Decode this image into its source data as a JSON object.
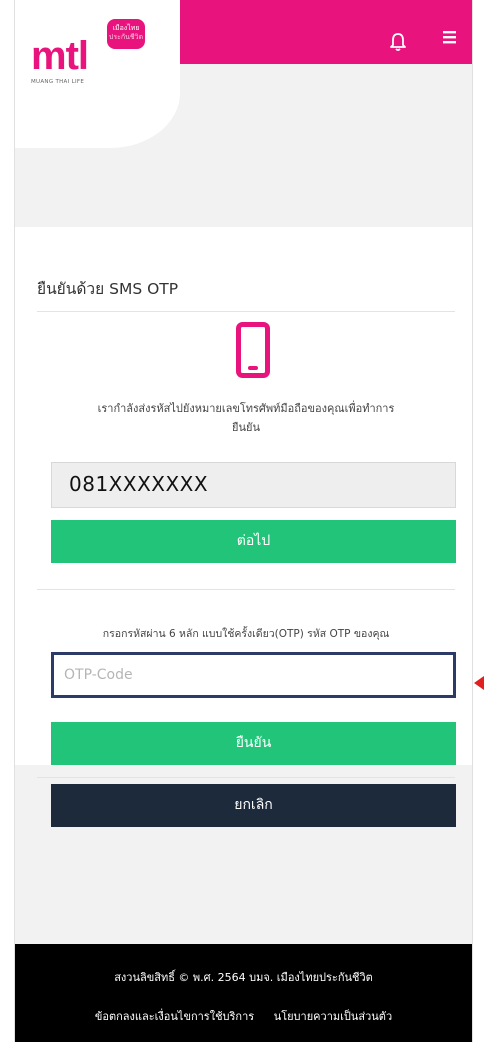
{
  "brand": {
    "logo_text": "mtl",
    "badge_line1": "เมืองไทย",
    "badge_line2": "ประกันชีวิต",
    "tagline": "MUANG THAI LIFE",
    "color": "#e8137c"
  },
  "header": {
    "icons": [
      "bell-icon",
      "menu-icon"
    ]
  },
  "verify": {
    "title": "ยืนยันด้วย SMS OTP",
    "icon": "mobile-phone-icon",
    "send_message_line1": "เรากำลังส่งรหัสไปยังหมายเลขโทรศัพท์มือถือของคุณเพื่อทำการ",
    "send_message_line2": "ยืนยัน",
    "phone_value": "081XXXXXXX",
    "next_label": "ต่อไป",
    "otp_instruction": "กรอกรหัสผ่าน 6 หลัก แบบใช้ครั้งเดียว(OTP) รหัส OTP ของคุณ",
    "otp_placeholder": "OTP-Code",
    "confirm_label": "ยืนยัน",
    "cancel_label": "ยกเลิก"
  },
  "footer": {
    "copyright": "สงวนลิขสิทธิ์ © พ.ศ. 2564 บมจ. เมืองไทยประกันชีวิต",
    "terms_link": "ข้อตกลงและเงื่อนไขการใช้บริการ",
    "privacy_link": "นโยบายความเป็นส่วนตัว"
  },
  "colors": {
    "accent_pink": "#e8137c",
    "button_green": "#22c47a",
    "button_dark": "#1d2a3c",
    "focus_border": "#2b3a67",
    "annotation_arrow": "#e02020"
  }
}
